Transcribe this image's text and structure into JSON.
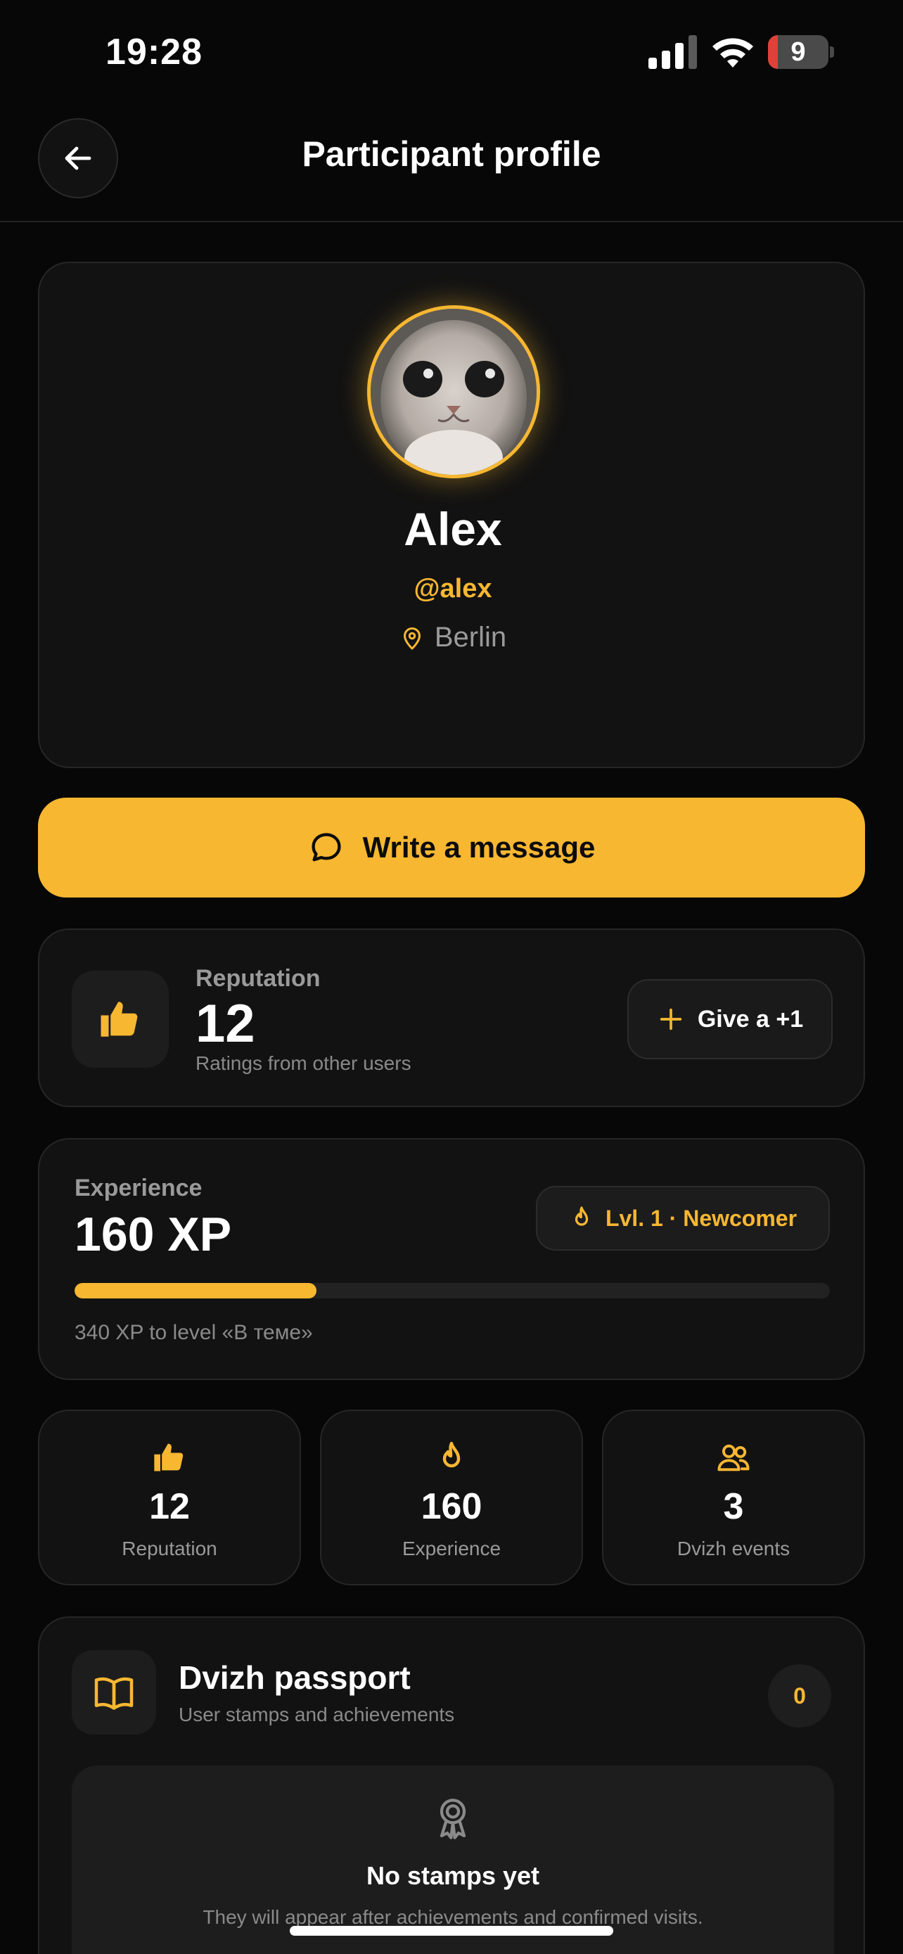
{
  "status_bar": {
    "time": "19:28",
    "battery": "9"
  },
  "header": {
    "title": "Participant profile"
  },
  "profile": {
    "name": "Alex",
    "handle": "@alex",
    "location": "Berlin"
  },
  "actions": {
    "message_label": "Write a message"
  },
  "reputation": {
    "label": "Reputation",
    "value": "12",
    "subtitle": "Ratings from other users",
    "give_label": "Give a +1"
  },
  "experience": {
    "label": "Experience",
    "value": "160 XP",
    "level_badge": "Lvl. 1 · Newcomer",
    "progress_fraction": 0.32,
    "next_level_text": "340 XP to level «В теме»"
  },
  "stats": [
    {
      "icon": "thumbs-up-icon",
      "value": "12",
      "label": "Reputation"
    },
    {
      "icon": "flame-icon",
      "value": "160",
      "label": "Experience"
    },
    {
      "icon": "users-icon",
      "value": "3",
      "label": "Dvizh events"
    }
  ],
  "passport": {
    "title": "Dvizh passport",
    "subtitle": "User stamps and achievements",
    "count": "0",
    "empty_title": "No stamps yet",
    "empty_subtitle": "They will appear after achievements and confirmed visits."
  },
  "colors": {
    "accent": "#f7b731",
    "background": "#070707",
    "card": "#121212"
  }
}
